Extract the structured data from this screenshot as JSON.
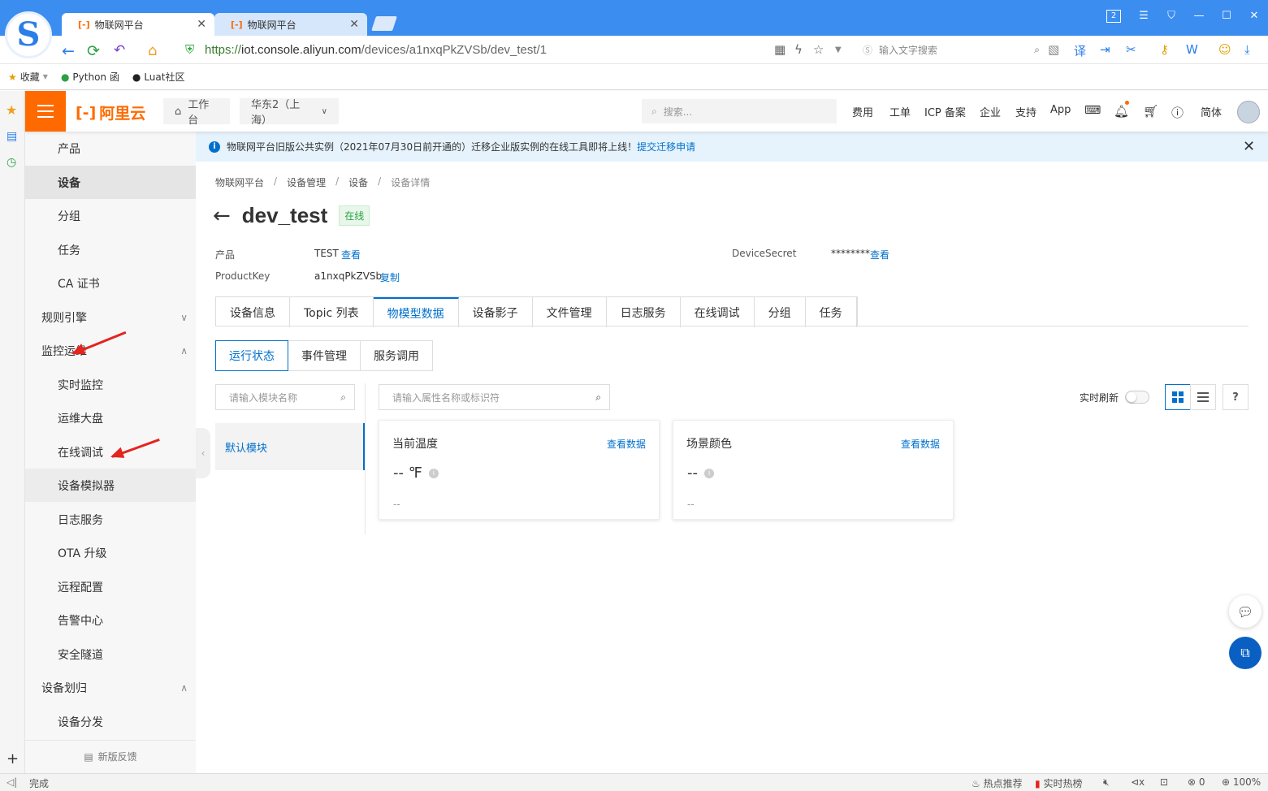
{
  "browser": {
    "tabs": [
      {
        "title": "物联网平台",
        "icon": "[-]"
      },
      {
        "title": "物联网平台",
        "icon": "[-]"
      }
    ],
    "url": {
      "scheme": "https://",
      "host": "iot.console.aliyun.com",
      "path": "/devices/a1nxqPkZVSb/dev_test/1"
    },
    "search_placeholder": "输入文字搜索",
    "window_badge": "2",
    "bookmarks": [
      {
        "label": "收藏"
      },
      {
        "label": "Python 函"
      },
      {
        "label": "Luat社区"
      }
    ],
    "status": {
      "left": "完成",
      "hot": "热点推荐",
      "realtime": "实时热榜",
      "count": "0",
      "zoom": "100%"
    }
  },
  "header": {
    "brand": "阿里云",
    "workbench": "工作台",
    "region": "华东2（上海）",
    "search_placeholder": "搜索...",
    "links": [
      "费用",
      "工单",
      "ICP 备案",
      "企业",
      "支持",
      "App"
    ],
    "lang": "简体"
  },
  "leftnav": {
    "items": [
      {
        "label": "产品",
        "type": "sub"
      },
      {
        "label": "设备",
        "type": "sub",
        "active": true
      },
      {
        "label": "分组",
        "type": "sub"
      },
      {
        "label": "任务",
        "type": "sub"
      },
      {
        "label": "CA 证书",
        "type": "sub"
      },
      {
        "label": "规则引擎",
        "type": "grp",
        "chev": "down"
      },
      {
        "label": "监控运维",
        "type": "grp",
        "chev": "up"
      },
      {
        "label": "实时监控",
        "type": "sub"
      },
      {
        "label": "运维大盘",
        "type": "sub"
      },
      {
        "label": "在线调试",
        "type": "sub"
      },
      {
        "label": "设备模拟器",
        "type": "sub",
        "hl": true
      },
      {
        "label": "日志服务",
        "type": "sub"
      },
      {
        "label": "OTA 升级",
        "type": "sub"
      },
      {
        "label": "远程配置",
        "type": "sub"
      },
      {
        "label": "告警中心",
        "type": "sub"
      },
      {
        "label": "安全隧道",
        "type": "sub"
      },
      {
        "label": "设备划归",
        "type": "grp",
        "chev": "up"
      },
      {
        "label": "设备分发",
        "type": "sub"
      }
    ],
    "feedback": "新版反馈"
  },
  "notice": {
    "text": "物联网平台旧版公共实例（2021年07月30日前开通的）迁移企业版实例的在线工具即将上线！",
    "link": "提交迁移申请"
  },
  "breadcrumb": [
    "物联网平台",
    "设备管理",
    "设备",
    "设备详情"
  ],
  "device": {
    "name": "dev_test",
    "status": "在线",
    "product_label": "产品",
    "product_value": "TEST",
    "product_link": "查看",
    "productkey_label": "ProductKey",
    "productkey_value": "a1nxqPkZVSb",
    "productkey_link": "复制",
    "secret_label": "DeviceSecret",
    "secret_value": "********",
    "secret_link": "查看"
  },
  "tabs": [
    "设备信息",
    "Topic 列表",
    "物模型数据",
    "设备影子",
    "文件管理",
    "日志服务",
    "在线调试",
    "分组",
    "任务"
  ],
  "active_tab": 2,
  "subtabs": [
    "运行状态",
    "事件管理",
    "服务调用"
  ],
  "active_subtab": 0,
  "module_search_placeholder": "请输入模块名称",
  "attr_search_placeholder": "请输入属性名称或标识符",
  "default_module": "默认模块",
  "realtime_refresh": "实时刷新",
  "realtime_refresh_on": false,
  "cards": [
    {
      "name": "当前温度",
      "link": "查看数据",
      "value": "-- ℉",
      "time": "--"
    },
    {
      "name": "场景颜色",
      "link": "查看数据",
      "value": "--",
      "time": "--"
    }
  ],
  "colors": {
    "brand": "#ff6a00",
    "primary": "#0070cc",
    "online": "#2aa044",
    "annotation_arrow": "#e5241e"
  }
}
